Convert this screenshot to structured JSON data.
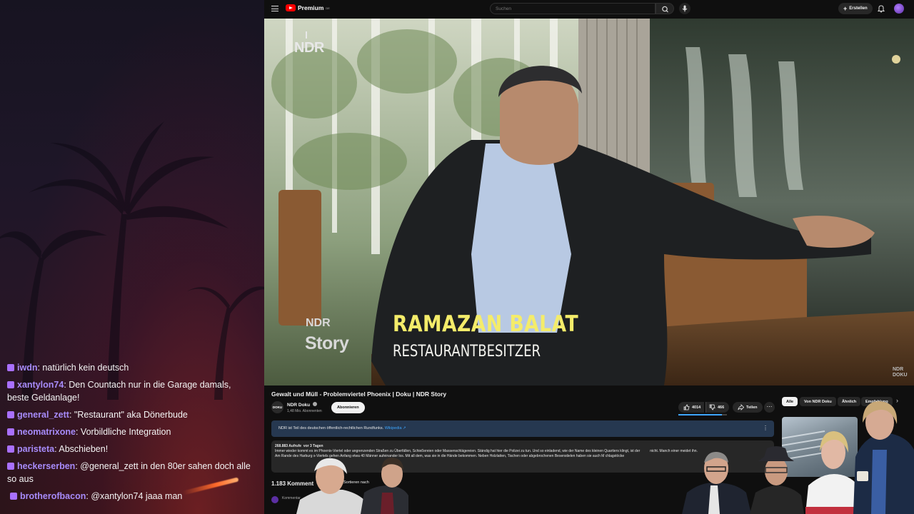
{
  "chat": {
    "messages": [
      {
        "user": "iwdn",
        "text": "natürlich kein deutsch"
      },
      {
        "user": "xantylon74",
        "text": "Den Countach nur in die Garage damals, beste Geldanlage!"
      },
      {
        "user": "general_zett",
        "text": "\"Restaurant\" aka Dönerbude"
      },
      {
        "user": "neomatrixone",
        "text": "Vorbildliche Integration"
      },
      {
        "user": "paristeta",
        "text": "Abschieben!"
      },
      {
        "user": "heckerserben",
        "text": "@general_zett in den 80er sahen doch alle so aus"
      },
      {
        "user": "brotherofbacon",
        "text": "@xantylon74 jaaa man"
      }
    ]
  },
  "youtube": {
    "logo_text": "Premium",
    "logo_sup": "DE",
    "search_placeholder": "Suchen",
    "create_label": "Erstellen",
    "video": {
      "brand": "NDR",
      "lower_third_ndr": "NDR",
      "lower_third_story": "Story",
      "person_name": "RAMAZAN BALAT",
      "person_role": "RESTAURANTBESITZER",
      "corner_logo_1": "NDR",
      "corner_logo_2": "DOKU"
    },
    "title": "Gewalt und Müll - Problemviertel Phoenix | Doku | NDR Story",
    "channel": {
      "avatar_text": "DOKU",
      "name": "NDR Doku",
      "subscribers": "1,48 Mio. Abonnenten",
      "subscribe_label": "Abonnieren"
    },
    "actions": {
      "likes": "4014",
      "dislikes": "466",
      "share": "Teilen",
      "like_ratio": 0.9
    },
    "info_panel": {
      "text": "NDR ist Teil des deutschen öffentlich-rechtlichen Rundfunks.",
      "link": "Wikipedia ↗"
    },
    "description": {
      "views": "268.883 Aufrufe",
      "age": "vor 3 Tagen",
      "line1": "Immer wieder kommt es im Phoenix-Viertel oder angrenzenden Straßen zu Überfällen, Schießereien oder Massenschlägereien. Ständig hat hier die Polizei zu tun. Und so einladend, wie der Name des kleinen Quartiers klingt, ist der",
      "line1_tail": "nicht. Manch einer meidet ihn.",
      "line2": "Am Rande des Harburg",
      "line2_mid": "s-Viertels gehen Anfang",
      "line2_rest": "etwa 40 Männer aufeinander los. Mit all dem, was sie in die Hände bekommen. Neben Holzlatten, Tischen oder abgebrochenen Besenstielen haben sie auch M",
      "line2_tail": "chlagstöcke"
    },
    "comments_count": "1.183 Komment",
    "sort_label": "Sortieren nach",
    "comment_placeholder": "Kommentar",
    "chips": [
      "Alle",
      "Von NDR Doku",
      "Ähnlich",
      "Empfehlung"
    ],
    "chip_arrow": "›"
  },
  "colors": {
    "username": "#a78bfa",
    "badge": "#a970ff",
    "accent_link": "#3ea6ff",
    "lower_third_name": "#f4ec6a",
    "yt_red": "#ff0000"
  }
}
